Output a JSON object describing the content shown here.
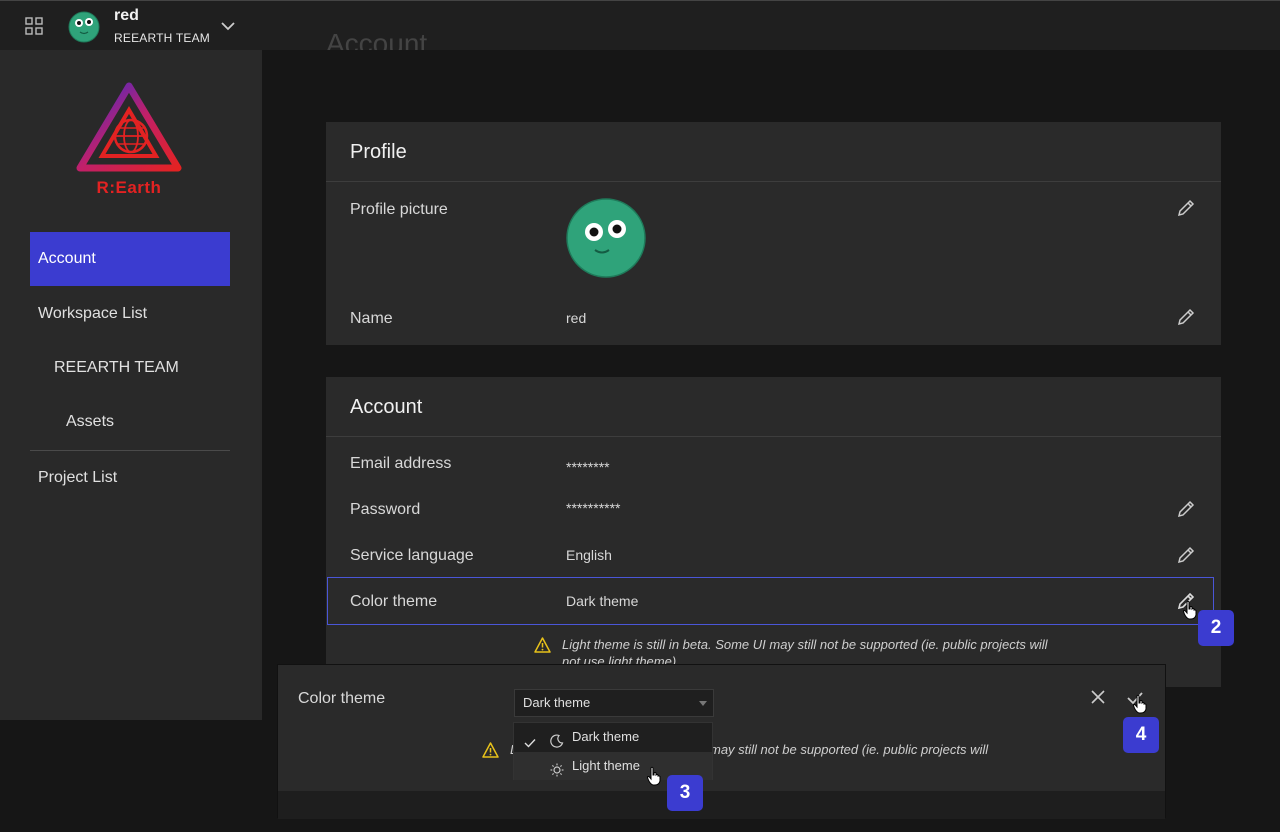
{
  "header": {
    "user_name": "red",
    "team_name": "REEARTH TEAM"
  },
  "sidebar": {
    "logo_text": "R:Earth",
    "items": [
      {
        "label": "Account",
        "active": true
      },
      {
        "label": "Workspace List"
      },
      {
        "label": "REEARTH TEAM"
      },
      {
        "label": "Assets"
      },
      {
        "label": "Project List"
      }
    ]
  },
  "main": {
    "page_title": "Account",
    "profile_card": {
      "title": "Profile",
      "picture_label": "Profile picture",
      "name_label": "Name",
      "name_value": "red"
    },
    "account_card": {
      "title": "Account",
      "email_label": "Email address",
      "email_value": "********",
      "password_label": "Password",
      "password_value": "**********",
      "language_label": "Service language",
      "language_value": "English",
      "theme_label": "Color theme",
      "theme_value": "Dark theme",
      "warning": "Light theme is still in beta. Some UI may still not be supported (ie. public projects will not use light theme)."
    }
  },
  "overlay": {
    "label": "Color theme",
    "selected": "Dark theme",
    "warning_prefix": "L",
    "warning_suffix": "may still not be supported (ie. public projects will",
    "options": [
      {
        "label": "Dark theme",
        "checked": true,
        "icon": "moon-icon"
      },
      {
        "label": "Light theme",
        "checked": false,
        "icon": "sun-icon"
      }
    ]
  },
  "badges": [
    "2",
    "3",
    "4"
  ],
  "colors": {
    "accent": "#3b3cd0",
    "warning": "#e8c21a",
    "avatar": "#2fa37a",
    "logo": "#e32222"
  }
}
